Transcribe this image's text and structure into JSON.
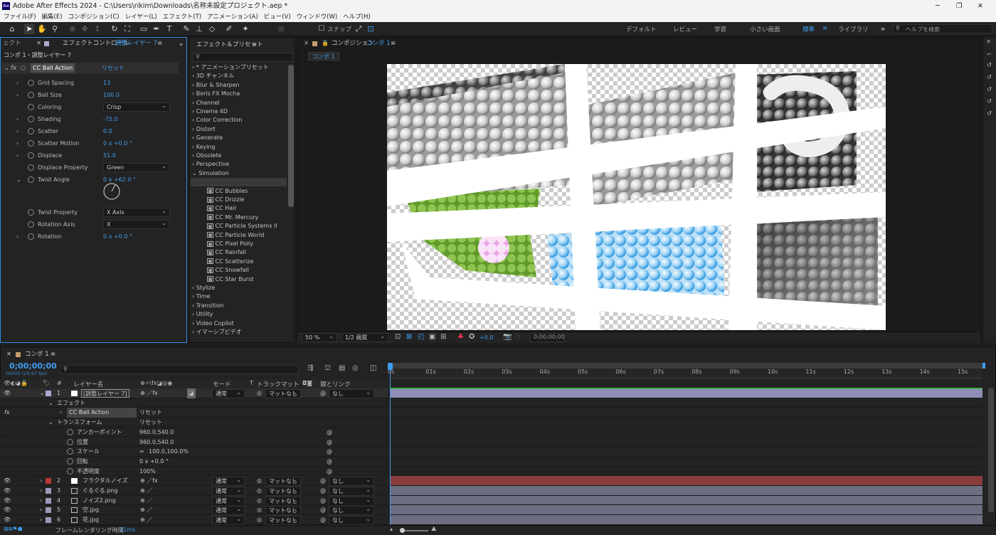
{
  "app": {
    "title": "Adobe After Effects 2024 - C:\\Users\\rikim\\Downloads\\名称未設定プロジェクト.aep *",
    "logo": "Ae"
  },
  "menu": [
    "ファイル(F)",
    "編集(E)",
    "コンポジション(C)",
    "レイヤー(L)",
    "エフェクト(T)",
    "アニメーション(A)",
    "ビュー(V)",
    "ウィンドウ(W)",
    "ヘルプ(H)"
  ],
  "toolbar": {
    "snap": "スナップ",
    "workspaces": [
      "デフォルト",
      "レビュー",
      "学習",
      "小さい画面",
      "標準",
      "ライブラリ"
    ],
    "active_workspace": "標準",
    "search_placeholder": "ヘルプを検索"
  },
  "effect_controls": {
    "tab_prefix": "エフェクトコントロール",
    "tab_layer": "調整レイヤー 7",
    "left_stub": "ェクト",
    "subtitle": "コンポ 1・調整レイヤー 7",
    "effect": "CC Ball Action",
    "reset": "リセット",
    "props": [
      {
        "name": "Grid Spacing",
        "value": "13"
      },
      {
        "name": "Ball Size",
        "value": "100.0"
      },
      {
        "name": "Coloring",
        "value": "Crisp",
        "dropdown": true
      },
      {
        "name": "Shading",
        "value": "-75.0"
      },
      {
        "name": "Scatter",
        "value": "0.0"
      },
      {
        "name": "Scatter Motion",
        "value": "0 x +0.0 °"
      },
      {
        "name": "Displace",
        "value": "51.0"
      },
      {
        "name": "Displace Property",
        "value": "Green",
        "dropdown": true
      },
      {
        "name": "Twist Angle",
        "value": "0 x +62.0 °"
      },
      {
        "name": "Twist Property",
        "value": "X Axis",
        "dropdown": true
      },
      {
        "name": "Rotation Axis",
        "value": "X",
        "dropdown": true
      },
      {
        "name": "Rotation",
        "value": "0 x +0.0 °"
      }
    ]
  },
  "presets": {
    "title": "エフェクト＆プリセット",
    "search_icon": "search-icon",
    "items": [
      "* アニメーションプリセット",
      "3D チャンネル",
      "Blur & Sharpen",
      "Boris FX Mocha",
      "Channel",
      "Cinema 4D",
      "Color Correction",
      "Distort",
      "Generate",
      "Keying",
      "Obsolete",
      "Perspective",
      "Simulation"
    ],
    "sim_items": [
      "CC Ball Action",
      "CC Bubbles",
      "CC Drizzle",
      "CC Hair",
      "CC Mr. Mercury",
      "CC Particle Systems II",
      "CC Particle World",
      "CC Pixel Polly",
      "CC Rainfall",
      "CC Scatterize",
      "CC Snowfall",
      "CC Star Burst"
    ],
    "items2": [
      "Stylize",
      "Time",
      "Transition",
      "Utility",
      "Video Copilot",
      "イマーシブビデオ"
    ]
  },
  "composition": {
    "tab_label": "コンポジション",
    "tab_name": "コンポ 1",
    "flow_tab": "コンポ 1",
    "zoom": "50 %",
    "resolution": "1/2 画質",
    "exposure": "+0.0",
    "timecode": "0;00;00;00"
  },
  "timeline": {
    "tab": "コンポ 1",
    "timecode": "0;00;00;00",
    "fps": "00000 (29.97 fps)",
    "headers": {
      "source": "レイヤー名",
      "mode": "モード",
      "t": "T",
      "trackmatte": "トラックマット",
      "parent": "親とリンク"
    },
    "ruler": [
      "0s",
      "01s",
      "02s",
      "03s",
      "04s",
      "05s",
      "06s",
      "07s",
      "08s",
      "09s",
      "10s",
      "11s",
      "12s",
      "13s",
      "14s",
      "15s"
    ],
    "layer1": {
      "num": "1",
      "name": "[調整レイヤー 7]",
      "mode": "通常",
      "matte": "マットなし",
      "parent": "なし"
    },
    "effects_group": "エフェクト",
    "effect_name": "CC Ball Action",
    "transform_group": "トランスフォーム",
    "reset": "リセット",
    "transform": [
      {
        "name": "アンカーポイント",
        "value": "960.0,540.0"
      },
      {
        "name": "位置",
        "value": "960.0,540.0"
      },
      {
        "name": "スケール",
        "value": "100.0,100.0%"
      },
      {
        "name": "回転",
        "value": "0 x +0.0 °"
      },
      {
        "name": "不透明度",
        "value": "100%"
      }
    ],
    "layers": [
      {
        "num": "2",
        "name": "フラクタルノイズ",
        "color": "#b83838",
        "mode": "通常",
        "matte": "マットなし",
        "parent": "なし"
      },
      {
        "num": "3",
        "name": "ぐるぐる.png",
        "color": "#9a9ab8",
        "mode": "通常",
        "matte": "マットなし",
        "parent": "なし"
      },
      {
        "num": "4",
        "name": "ノイズ2.png",
        "color": "#9a9ab8",
        "mode": "通常",
        "matte": "マットなし",
        "parent": "なし"
      },
      {
        "num": "5",
        "name": "空.jpg",
        "color": "#9a9ab8",
        "mode": "通常",
        "matte": "マットなし",
        "parent": "なし"
      },
      {
        "num": "6",
        "name": "花.jpg",
        "color": "#9a9ab8",
        "mode": "通常",
        "matte": "マットなし",
        "parent": "なし"
      }
    ],
    "render_label": "フレームレンダリング時間",
    "render_value": "21ms"
  },
  "colors": {
    "accent": "#2d8ceb",
    "layer_adj": "#8f8fba",
    "layer_noise": "#8b3c3c",
    "layer_footage": "#6e6e82"
  }
}
